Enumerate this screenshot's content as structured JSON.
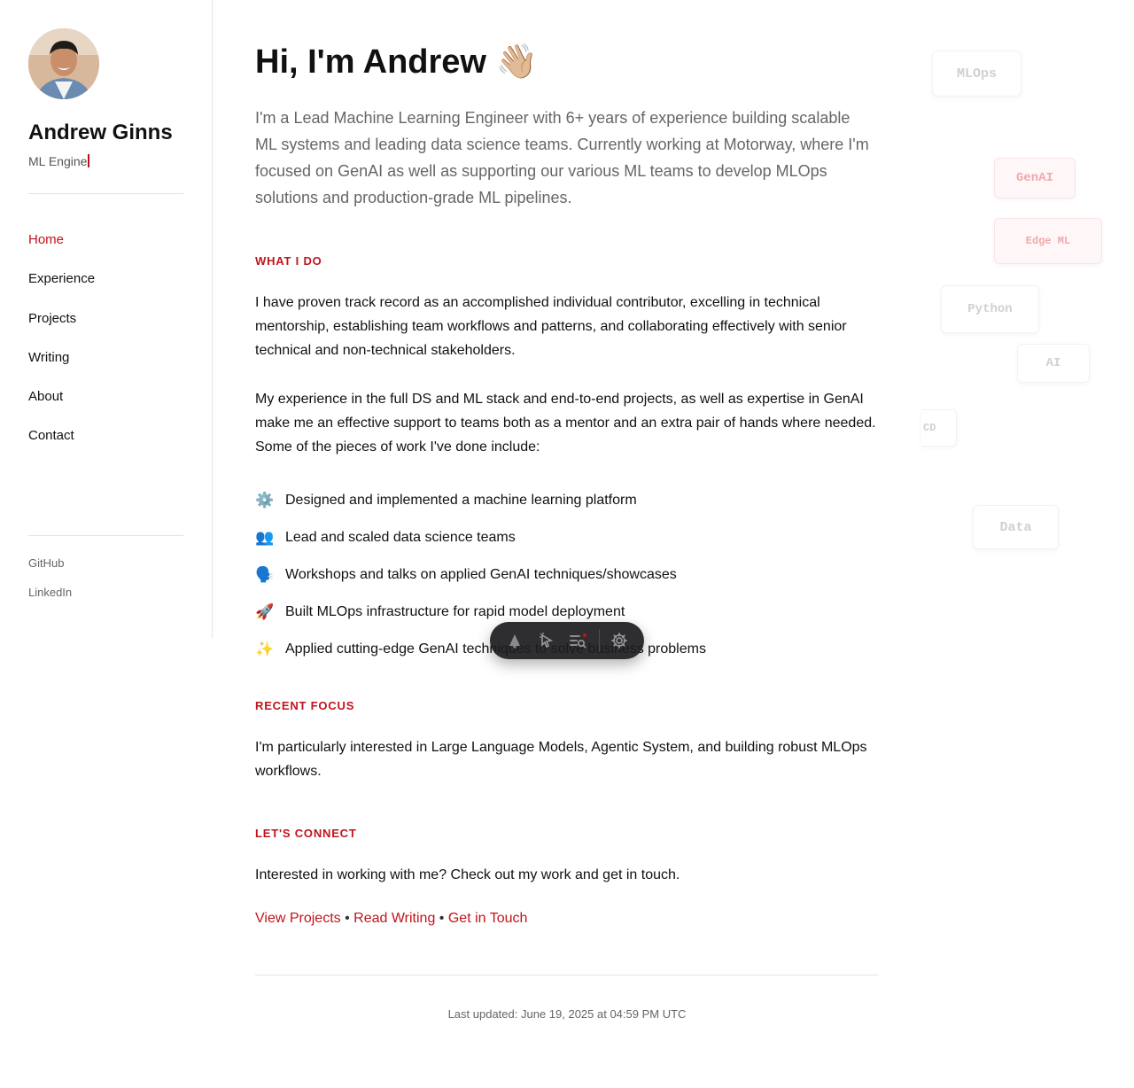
{
  "sidebar": {
    "name": "Andrew Ginns",
    "role_typed": "ML Engine",
    "nav": [
      {
        "label": "Home",
        "active": true
      },
      {
        "label": "Experience",
        "active": false
      },
      {
        "label": "Projects",
        "active": false
      },
      {
        "label": "Writing",
        "active": false
      },
      {
        "label": "About",
        "active": false
      },
      {
        "label": "Contact",
        "active": false
      }
    ],
    "social": [
      "GitHub",
      "LinkedIn"
    ]
  },
  "main": {
    "greeting": "Hi, I'm Andrew 👋🏼",
    "intro": "I'm a Lead Machine Learning Engineer with 6+ years of experience building scalable ML systems and leading data science teams. Currently working at Motorway, where I'm focused on GenAI as well as supporting our various ML teams to develop MLOps solutions and production-grade ML pipelines.",
    "what_i_do": {
      "title": "WHAT I DO",
      "para1": "I have proven track record as an accomplished individual contributor, excelling in technical mentorship, establishing team workflows and patterns, and collaborating effectively with senior technical and non-technical stakeholders.",
      "para2": "My experience in the full DS and ML stack and end-to-end projects, as well as expertise in GenAI make me an effective support to teams both as a mentor and an extra pair of hands where needed. Some of the pieces of work I've done include:",
      "items": [
        {
          "emoji": "⚙️",
          "text": "Designed and implemented a machine learning platform"
        },
        {
          "emoji": "👥",
          "text": "Lead and scaled data science teams"
        },
        {
          "emoji": "🗣️",
          "text": "Workshops and talks on applied GenAI techniques/showcases"
        },
        {
          "emoji": "🚀",
          "text": "Built MLOps infrastructure for rapid model deployment"
        },
        {
          "emoji": "✨",
          "text": "Applied cutting-edge GenAI techniques to solve business problems"
        }
      ]
    },
    "recent_focus": {
      "title": "RECENT FOCUS",
      "text": "I'm particularly interested in Large Language Models, Agentic System, and building robust MLOps workflows."
    },
    "connect": {
      "title": "LET'S CONNECT",
      "text": "Interested in working with me? Check out my work and get in touch.",
      "links": [
        "View Projects",
        "Read Writing",
        "Get in Touch"
      ],
      "separator": "•"
    },
    "footer": "Last updated: June 19, 2025 at 04:59 PM UTC"
  },
  "floating_tags": [
    {
      "label": "MLOps",
      "style": "grey"
    },
    {
      "label": "GenAI",
      "style": "red"
    },
    {
      "label": "Edge ML",
      "style": "red"
    },
    {
      "label": "Python",
      "style": "grey"
    },
    {
      "label": "AI",
      "style": "grey"
    },
    {
      "label": "CD",
      "style": "grey"
    },
    {
      "label": "Data",
      "style": "grey"
    }
  ],
  "toolbar": {
    "icons": [
      "notification-icon",
      "cursor-select-icon",
      "list-search-icon",
      "gear-icon"
    ]
  },
  "colors": {
    "accent": "#c0141c",
    "text": "#111111",
    "muted": "#666666"
  }
}
